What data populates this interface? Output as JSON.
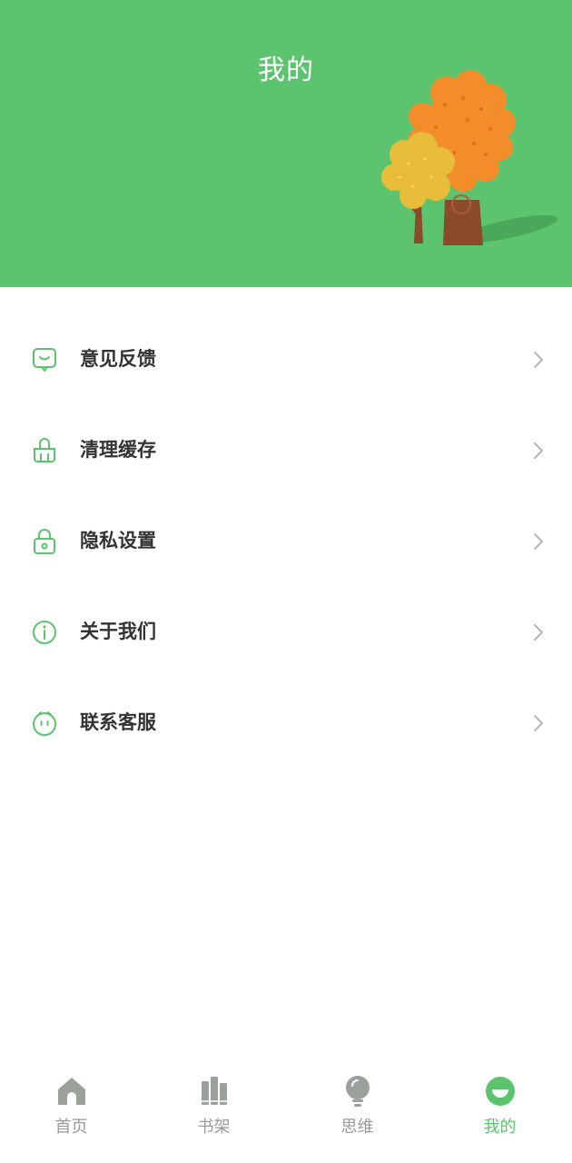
{
  "header": {
    "title": "我的"
  },
  "menu": {
    "items": [
      {
        "label": "意见反馈",
        "icon": "feedback-chat-icon"
      },
      {
        "label": "清理缓存",
        "icon": "clean-basket-icon"
      },
      {
        "label": "隐私设置",
        "icon": "lock-icon"
      },
      {
        "label": "关于我们",
        "icon": "info-circle-icon"
      },
      {
        "label": "联系客服",
        "icon": "customer-service-face-icon"
      }
    ]
  },
  "nav": {
    "items": [
      {
        "label": "首页",
        "icon": "home-icon",
        "active": false
      },
      {
        "label": "书架",
        "icon": "bookshelf-icon",
        "active": false
      },
      {
        "label": "思维",
        "icon": "lightbulb-icon",
        "active": false
      },
      {
        "label": "我的",
        "icon": "smile-face-icon",
        "active": true
      }
    ]
  },
  "colors": {
    "primary": "#5cc46e",
    "inactive": "#9a9a9a",
    "text": "#333333"
  }
}
